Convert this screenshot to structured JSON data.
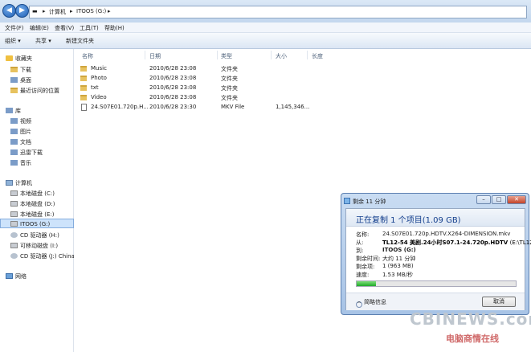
{
  "address": {
    "path": [
      "计算机",
      "ITOOS (G:)"
    ]
  },
  "menu": [
    "文件(F)",
    "编辑(E)",
    "查看(V)",
    "工具(T)",
    "帮助(H)"
  ],
  "toolbar": {
    "organize": "组织 ▾",
    "share": "共享 ▾",
    "new_folder": "新建文件夹"
  },
  "nav": {
    "favorites": {
      "title": "收藏夹",
      "items": [
        "下载",
        "桌面",
        "最近访问的位置"
      ]
    },
    "libraries": {
      "title": "库",
      "items": [
        "视频",
        "图片",
        "文档",
        "迅雷下载",
        "音乐"
      ]
    },
    "computer": {
      "title": "计算机",
      "items": [
        "本地磁盘 (C:)",
        "本地磁盘 (D:)",
        "本地磁盘 (E:)",
        "ITOOS (G:)",
        "CD 驱动器 (H:)",
        "可移动磁盘 (I:)",
        "CD 驱动器 (J:) ChinaT"
      ]
    },
    "network": {
      "title": "网络"
    }
  },
  "columns": {
    "name": "名称",
    "date": "日期",
    "type": "类型",
    "size": "大小",
    "length": "长度"
  },
  "files": [
    {
      "name": "Music",
      "date": "2010/6/28 23:08",
      "type": "文件夹",
      "size": ""
    },
    {
      "name": "Photo",
      "date": "2010/6/28 23:08",
      "type": "文件夹",
      "size": ""
    },
    {
      "name": "txt",
      "date": "2010/6/28 23:08",
      "type": "文件夹",
      "size": ""
    },
    {
      "name": "Video",
      "date": "2010/6/28 23:08",
      "type": "文件夹",
      "size": ""
    },
    {
      "name": "24.S07E01.720p.H...",
      "date": "2010/6/28 23:30",
      "type": "MKV File",
      "size": "1,145,346..."
    }
  ],
  "dialog": {
    "title": "剩余 11 分钟",
    "heading": "正在复制 1 个项目(1.09 GB)",
    "name_label": "名称:",
    "name_value": "24.S07E01.720p.HDTV.X264-DIMENSION.mkv",
    "from_label": "从:",
    "from_value": "TL12-54 美剧.24小时S07.1-24.720p.HDTV",
    "from_path": "(E:\\TL12-5",
    "to_label": "到:",
    "to_value": "ITOOS (G:)",
    "time_label": "剩余时间:",
    "time_value": "大约 11 分钟",
    "items_label": "剩余项:",
    "items_value": "1 (963 MB)",
    "speed_label": "速度:",
    "speed_value": "1.53 MB/秒",
    "progress": 0.12,
    "more_info": "简略信息",
    "cancel": "取消"
  },
  "watermark": {
    "text": "CBINEWS.com",
    "sub": "电脑商情在线"
  }
}
